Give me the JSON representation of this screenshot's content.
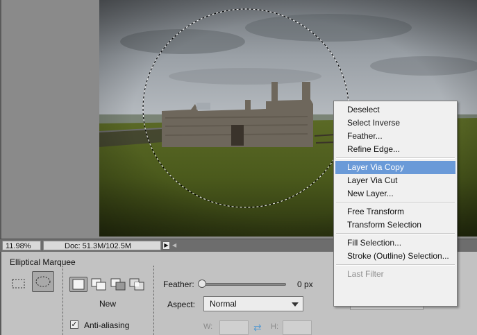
{
  "status_bar": {
    "zoom": "11.98%",
    "doc_info": "Doc: 51.3M/102.5M"
  },
  "options_bar": {
    "tool_name": "Elliptical Marquee",
    "selection_mode_label": "New",
    "anti_aliasing_label": "Anti-aliasing",
    "anti_aliasing_checked": true,
    "feather_label": "Feather:",
    "feather_value": "0 px",
    "feather_level": 0,
    "aspect_label": "Aspect:",
    "aspect_value": "Normal",
    "width_label": "W:",
    "height_label": "H:"
  },
  "context_menu": {
    "highlighted": "Layer Via Copy",
    "groups": [
      [
        "Deselect",
        "Select Inverse",
        "Feather...",
        "Refine Edge..."
      ],
      [
        "Layer Via Copy",
        "Layer Via Cut",
        "New Layer..."
      ],
      [
        "Free Transform",
        "Transform Selection"
      ],
      [
        "Fill Selection...",
        "Stroke (Outline) Selection..."
      ],
      [
        "Last Filter"
      ]
    ],
    "disabled": [
      "Last Filter"
    ]
  },
  "colors": {
    "highlight": "#6a9ad8",
    "menu_background": "#f0f0f0",
    "options_background": "#c2c2c2",
    "canvas_background": "#8a8a8a"
  }
}
